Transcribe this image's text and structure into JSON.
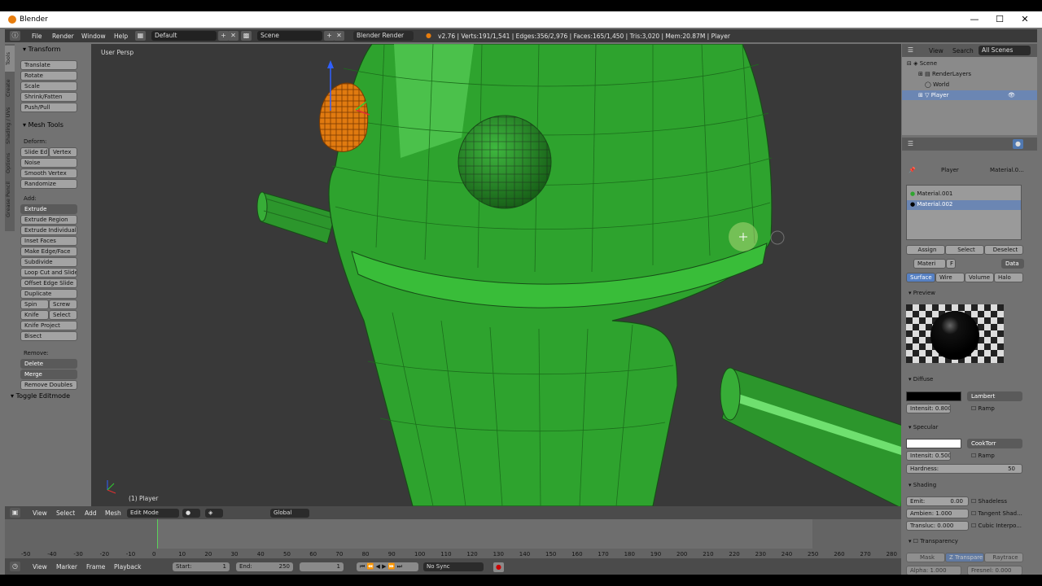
{
  "window": {
    "title": "Blender",
    "minimize": "—",
    "maximize": "☐",
    "close": "✕"
  },
  "info_header": {
    "menus": [
      "File",
      "Render",
      "Window",
      "Help"
    ],
    "layout": "Default",
    "scene": "Scene",
    "engine": "Blender Render",
    "stats": "v2.76 | Verts:191/1,541 | Edges:356/2,976 | Faces:165/1,450 | Tris:3,020 | Mem:20.87M | Player"
  },
  "viewport": {
    "view_label": "User Persp",
    "object_label": "(1) Player"
  },
  "tabs": [
    "Tools",
    "Create",
    "Shading / UVs",
    "Options",
    "Grease Pencil"
  ],
  "toolshelf": {
    "transform_header": "Transform",
    "transform": [
      "Translate",
      "Rotate",
      "Scale",
      "Shrink/Fatten",
      "Push/Pull"
    ],
    "mesh_tools_header": "Mesh Tools",
    "deform_label": "Deform:",
    "deform_row": [
      "Slide Ed",
      "Vertex"
    ],
    "deform": [
      "Noise",
      "Smooth Vertex",
      "Randomize"
    ],
    "add_label": "Add:",
    "extrude": "Extrude",
    "add": [
      "Extrude Region",
      "Extrude Individual",
      "Inset Faces",
      "Make Edge/Face",
      "Subdivide",
      "Loop Cut and Slide",
      "Offset Edge Slide",
      "Duplicate"
    ],
    "spin_row": [
      "Spin",
      "Screw"
    ],
    "knife_row": [
      "Knife",
      "Select"
    ],
    "add2": [
      "Knife Project",
      "Bisect"
    ],
    "remove_label": "Remove:",
    "delete": "Delete",
    "merge": "Merge",
    "remove_doubles": "Remove Doubles",
    "toggle_editmode": "Toggle Editmode"
  },
  "outliner": {
    "menus": [
      "View",
      "Search"
    ],
    "filter": "All Scenes",
    "items": [
      "Scene",
      "RenderLayers",
      "World",
      "Player"
    ]
  },
  "properties": {
    "context": [
      "Player",
      "Material.0..."
    ],
    "materials": [
      "Material.001",
      "Material.002"
    ],
    "slot_buttons": [
      "Assign",
      "Select",
      "Deselect"
    ],
    "mat_name": "Materi",
    "mat_f": "F",
    "data": "Data",
    "mat_tabs": [
      "Surface",
      "Wire",
      "Volume",
      "Halo"
    ],
    "preview": "Preview",
    "diffuse": "Diffuse",
    "diffuse_shader": "Lambert",
    "diffuse_intensity": "Intensit: 0.800",
    "ramp": "Ramp",
    "specular": "Specular",
    "specular_shader": "CookTorr",
    "specular_intensity": "Intensit: 0.500",
    "hardness_label": "Hardness:",
    "hardness_value": "50",
    "shading": "Shading",
    "emit_label": "Emit:",
    "emit_value": "0.00",
    "ambient_label": "Ambien: 1.000",
    "translucency_label": "Transluc: 0.000",
    "shading_checks": [
      "Shadeless",
      "Tangent Shad...",
      "Cubic Interpo..."
    ],
    "transparency": "Transparency",
    "trans_tabs": [
      "Mask",
      "Z Transpare",
      "Raytrace"
    ],
    "alpha": "Alpha: 1.000",
    "fresnel": "Fresnel: 0.000"
  },
  "view_header": {
    "menus": [
      "View",
      "Select",
      "Add",
      "Mesh"
    ],
    "mode": "Edit Mode",
    "orientation": "Global"
  },
  "timeline": {
    "ticks": [
      "-50",
      "-40",
      "-30",
      "-20",
      "-10",
      "0",
      "10",
      "20",
      "30",
      "40",
      "50",
      "60",
      "70",
      "80",
      "90",
      "100",
      "110",
      "120",
      "130",
      "140",
      "150",
      "160",
      "170",
      "180",
      "190",
      "200",
      "210",
      "220",
      "230",
      "240",
      "250",
      "260",
      "270",
      "280"
    ]
  },
  "tl_header": {
    "menus": [
      "View",
      "Marker",
      "Frame",
      "Playback"
    ],
    "start": "Start:",
    "start_val": "1",
    "end": "End:",
    "end_val": "250",
    "current": "1",
    "sync": "No Sync"
  },
  "colors": {
    "mesh_green": "#2fa52f",
    "selected_orange": "#e07a10",
    "viewport_bg": "#393939"
  }
}
